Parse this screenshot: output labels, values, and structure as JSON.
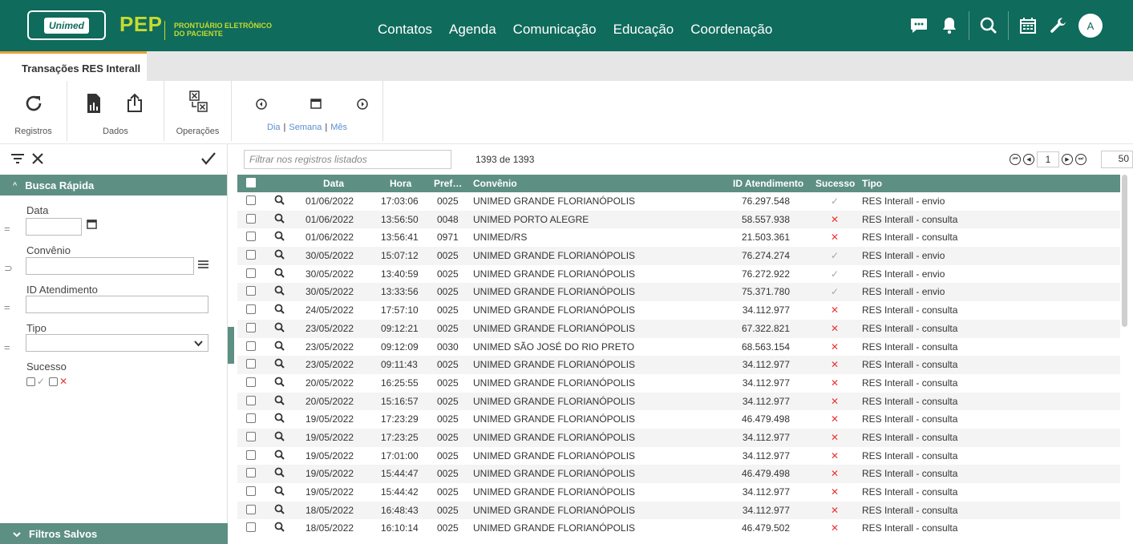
{
  "header": {
    "brand": "Unimed",
    "app_name": "PEP",
    "app_desc_line1": "PRONTUÁRIO ELETRÔNICO",
    "app_desc_line2": "DO PACIENTE",
    "nav": [
      "Contatos",
      "Agenda",
      "Comunicação",
      "Educação",
      "Coordenação"
    ],
    "icons": [
      "chat-icon",
      "bell-icon",
      "search-icon",
      "calendar-icon",
      "wrench-icon"
    ],
    "avatar": "A",
    "colors": {
      "bar": "#0f6b5c",
      "accent": "#c6db2f"
    }
  },
  "tabs": {
    "active": "Transações RES Interall"
  },
  "toolbar": {
    "groups": [
      "Registros",
      "Dados",
      "Operações"
    ],
    "views": [
      "Dia",
      "Semana",
      "Mês"
    ]
  },
  "left_panel": {
    "quick_search_title": "Busca Rápida",
    "fields": {
      "data_label": "Data",
      "data_op": "=",
      "convenio_label": "Convênio",
      "convenio_op": "⊃",
      "id_label": "ID Atendimento",
      "id_op": "=",
      "tipo_label": "Tipo",
      "tipo_op": "=",
      "sucesso_label": "Sucesso"
    },
    "saved_filters_title": "Filtros Salvos"
  },
  "grid": {
    "filter_placeholder": "Filtrar nos registros listados",
    "count": "1393 de 1393",
    "page": "1",
    "page_size": "50",
    "columns": [
      "Data",
      "Hora",
      "Pref…",
      "Convênio",
      "ID Atendimento",
      "Sucesso",
      "Tipo"
    ],
    "rows": [
      {
        "data": "01/06/2022",
        "hora": "17:03:06",
        "pref": "0025",
        "convenio": "UNIMED GRANDE FLORIANÓPOLIS",
        "id": "76.297.548",
        "ok": true,
        "tipo": "RES Interall - envio"
      },
      {
        "data": "01/06/2022",
        "hora": "13:56:50",
        "pref": "0048",
        "convenio": "UNIMED PORTO ALEGRE",
        "id": "58.557.938",
        "ok": false,
        "tipo": "RES Interall - consulta"
      },
      {
        "data": "01/06/2022",
        "hora": "13:56:41",
        "pref": "0971",
        "convenio": "UNIMED/RS",
        "id": "21.503.361",
        "ok": false,
        "tipo": "RES Interall - consulta"
      },
      {
        "data": "30/05/2022",
        "hora": "15:07:12",
        "pref": "0025",
        "convenio": "UNIMED GRANDE FLORIANÓPOLIS",
        "id": "76.274.274",
        "ok": true,
        "tipo": "RES Interall - envio"
      },
      {
        "data": "30/05/2022",
        "hora": "13:40:59",
        "pref": "0025",
        "convenio": "UNIMED GRANDE FLORIANÓPOLIS",
        "id": "76.272.922",
        "ok": true,
        "tipo": "RES Interall - envio"
      },
      {
        "data": "30/05/2022",
        "hora": "13:33:56",
        "pref": "0025",
        "convenio": "UNIMED GRANDE FLORIANÓPOLIS",
        "id": "75.371.780",
        "ok": true,
        "tipo": "RES Interall - envio"
      },
      {
        "data": "24/05/2022",
        "hora": "17:57:10",
        "pref": "0025",
        "convenio": "UNIMED GRANDE FLORIANÓPOLIS",
        "id": "34.112.977",
        "ok": false,
        "tipo": "RES Interall - consulta"
      },
      {
        "data": "23/05/2022",
        "hora": "09:12:21",
        "pref": "0025",
        "convenio": "UNIMED GRANDE FLORIANÓPOLIS",
        "id": "67.322.821",
        "ok": false,
        "tipo": "RES Interall - consulta"
      },
      {
        "data": "23/05/2022",
        "hora": "09:12:09",
        "pref": "0030",
        "convenio": "UNIMED SÃO JOSÉ DO RIO PRETO",
        "id": "68.563.154",
        "ok": false,
        "tipo": "RES Interall - consulta"
      },
      {
        "data": "23/05/2022",
        "hora": "09:11:43",
        "pref": "0025",
        "convenio": "UNIMED GRANDE FLORIANÓPOLIS",
        "id": "34.112.977",
        "ok": false,
        "tipo": "RES Interall - consulta"
      },
      {
        "data": "20/05/2022",
        "hora": "16:25:55",
        "pref": "0025",
        "convenio": "UNIMED GRANDE FLORIANÓPOLIS",
        "id": "34.112.977",
        "ok": false,
        "tipo": "RES Interall - consulta"
      },
      {
        "data": "20/05/2022",
        "hora": "15:16:57",
        "pref": "0025",
        "convenio": "UNIMED GRANDE FLORIANÓPOLIS",
        "id": "34.112.977",
        "ok": false,
        "tipo": "RES Interall - consulta"
      },
      {
        "data": "19/05/2022",
        "hora": "17:23:29",
        "pref": "0025",
        "convenio": "UNIMED GRANDE FLORIANÓPOLIS",
        "id": "46.479.498",
        "ok": false,
        "tipo": "RES Interall - consulta"
      },
      {
        "data": "19/05/2022",
        "hora": "17:23:25",
        "pref": "0025",
        "convenio": "UNIMED GRANDE FLORIANÓPOLIS",
        "id": "34.112.977",
        "ok": false,
        "tipo": "RES Interall - consulta"
      },
      {
        "data": "19/05/2022",
        "hora": "17:01:00",
        "pref": "0025",
        "convenio": "UNIMED GRANDE FLORIANÓPOLIS",
        "id": "34.112.977",
        "ok": false,
        "tipo": "RES Interall - consulta"
      },
      {
        "data": "19/05/2022",
        "hora": "15:44:47",
        "pref": "0025",
        "convenio": "UNIMED GRANDE FLORIANÓPOLIS",
        "id": "46.479.498",
        "ok": false,
        "tipo": "RES Interall - consulta"
      },
      {
        "data": "19/05/2022",
        "hora": "15:44:42",
        "pref": "0025",
        "convenio": "UNIMED GRANDE FLORIANÓPOLIS",
        "id": "34.112.977",
        "ok": false,
        "tipo": "RES Interall - consulta"
      },
      {
        "data": "18/05/2022",
        "hora": "16:48:43",
        "pref": "0025",
        "convenio": "UNIMED GRANDE FLORIANÓPOLIS",
        "id": "34.112.977",
        "ok": false,
        "tipo": "RES Interall - consulta"
      },
      {
        "data": "18/05/2022",
        "hora": "16:10:14",
        "pref": "0025",
        "convenio": "UNIMED GRANDE FLORIANÓPOLIS",
        "id": "46.479.502",
        "ok": false,
        "tipo": "RES Interall - consulta"
      }
    ]
  }
}
